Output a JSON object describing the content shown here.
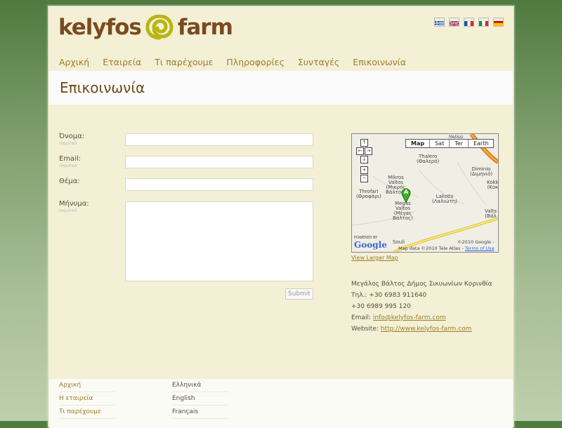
{
  "brand": {
    "logo_left": "kelyfos",
    "logo_right": "farm"
  },
  "languages": [
    {
      "name": "Greek",
      "icon": "flag-gr-icon"
    },
    {
      "name": "English",
      "icon": "flag-uk-icon"
    },
    {
      "name": "French",
      "icon": "flag-fr-icon"
    },
    {
      "name": "Italian",
      "icon": "flag-it-icon"
    },
    {
      "name": "Spanish",
      "icon": "flag-es-icon"
    }
  ],
  "nav": [
    "Αρχική",
    "Εταιρεία",
    "Τι παρέχουμε",
    "Πληροφορίες",
    "Συνταγές",
    "Επικοινωνία"
  ],
  "page_title": "Επικοινωνία",
  "form": {
    "name_label": "Όνομα:",
    "email_label": "Email:",
    "subject_label": "Θέμα:",
    "message_label": "Μήνυμα:",
    "required": "required",
    "submit": "Submit"
  },
  "map": {
    "types": [
      "Map",
      "Sat",
      "Ter",
      "Earth"
    ],
    "labels": {
      "melissi": "Melissi",
      "thalero": "Thalero",
      "thalero_gr": "(Θαλερό)",
      "diminio": "Diminio",
      "diminio_gr": "(Διμηνιό)",
      "mikros": "Mikros",
      "valtos": "Valtos",
      "mikros_gr": "(Μικρός",
      "valtos_gr": "Βάλτος)",
      "kokk": "Kokk",
      "kokk_gr": "(Κοκ",
      "throfari": "Throfari",
      "throfari_gr": "(Θροφάρι)",
      "megas": "Megas",
      "megas_gr": "(Μέγας",
      "laliotis": "Laliotis",
      "laliotis_gr": "(Λαλιώτη)",
      "valts": "Valts",
      "valts_gr": "(Βάλ",
      "souli": "Souli",
      "marker": "A"
    },
    "powered_by": "POWERED BY",
    "google": "Google",
    "copyright": "©2010 Google -",
    "attribution": "Map data ©2010 Tele Atlas -",
    "terms": "Terms of Use",
    "larger_map": "View Larger Map"
  },
  "contact": {
    "address": "Μεγάλος Βάλτος Δήμος Σικυωνίων Κορινθία",
    "phone1": "Τηλ.: +30 6983 911640",
    "phone2": "+30 6989 995 120",
    "email_label": "Email: ",
    "email": "info@kelyfos-farm.com",
    "website_label": "Website: ",
    "website": "http://www.kelyfos-farm.com"
  },
  "footer": {
    "col1": [
      "Αρχική",
      "Η εταιρεία",
      "Τι παρέχουμε"
    ],
    "col2": [
      "Ελληνικά",
      "English",
      "Français"
    ]
  },
  "colors": {
    "accent": "#a07c2c",
    "brown": "#7a4a1e",
    "logo_green": "#b9b512",
    "background": "#f3f0d6"
  }
}
